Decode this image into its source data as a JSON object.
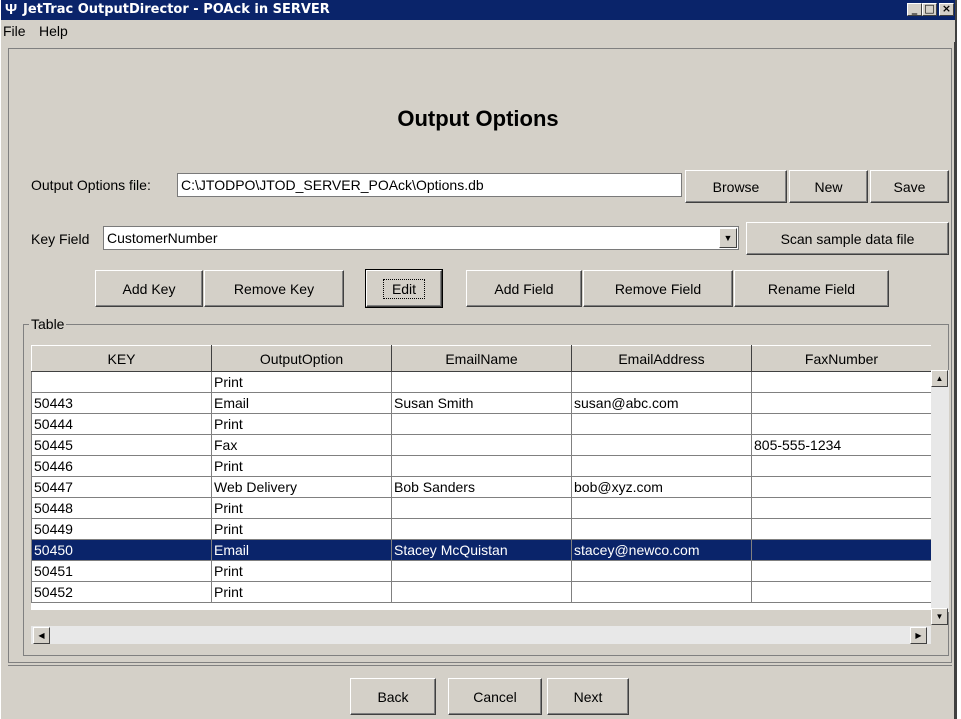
{
  "window": {
    "title": "JetTrac OutputDirector - POAck in SERVER",
    "controls": [
      "_",
      "□",
      "×"
    ]
  },
  "menu": [
    "File",
    "Help"
  ],
  "heading": "Output Options",
  "options_file": {
    "label": "Output Options file:",
    "value": "C:\\JTODPO\\JTOD_SERVER_POAck\\Options.db",
    "browse_label": "Browse",
    "new_label": "New",
    "save_label": "Save"
  },
  "key_field": {
    "label": "Key Field",
    "value": "CustomerNumber",
    "scan_label": "Scan sample data file"
  },
  "toolbar": {
    "add_key": "Add Key",
    "remove_key": "Remove Key",
    "edit": "Edit",
    "add_field": "Add Field",
    "remove_field": "Remove Field",
    "rename_field": "Rename Field"
  },
  "table": {
    "group_label": "Table",
    "columns": [
      "KEY",
      "OutputOption",
      "EmailName",
      "EmailAddress",
      "FaxNumber"
    ],
    "rows": [
      [
        "",
        "Print",
        "",
        "",
        ""
      ],
      [
        "50443",
        "Email",
        "Susan Smith",
        "susan@abc.com",
        ""
      ],
      [
        "50444",
        "Print",
        "",
        "",
        ""
      ],
      [
        "50445",
        "Fax",
        "",
        "",
        "805-555-1234"
      ],
      [
        "50446",
        "Print",
        "",
        "",
        ""
      ],
      [
        "50447",
        "Web Delivery",
        "Bob Sanders",
        "bob@xyz.com",
        ""
      ],
      [
        "50448",
        "Print",
        "",
        "",
        ""
      ],
      [
        "50449",
        "Print",
        "",
        "",
        ""
      ],
      [
        "50450",
        "Email",
        "Stacey McQuistan",
        "stacey@newco.com",
        ""
      ],
      [
        "50451",
        "Print",
        "",
        "",
        ""
      ],
      [
        "50452",
        "Print",
        "",
        "",
        ""
      ]
    ],
    "selected_row_index": 8,
    "selection_color": "#0a246a"
  },
  "footer": {
    "back": "Back",
    "cancel": "Cancel",
    "next": "Next"
  },
  "colors": {
    "titlebar": "#0a246a",
    "face": "#d4d0c8"
  }
}
